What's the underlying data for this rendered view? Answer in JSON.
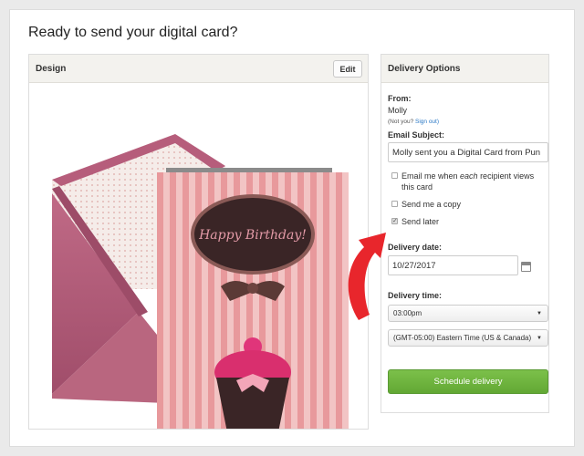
{
  "page": {
    "title": "Ready to send your digital card?"
  },
  "design": {
    "title": "Design",
    "edit_label": "Edit",
    "card_text": "Happy Birthday!"
  },
  "delivery": {
    "title": "Delivery Options",
    "from_label": "From:",
    "from_name": "Molly",
    "not_you": "(Not you?",
    "sign_out": "Sign out)",
    "subject_label": "Email Subject:",
    "subject_value": "Molly sent you a Digital Card from Pun",
    "checkboxes": [
      {
        "prefix": "Email me when ",
        "emph": "each",
        "suffix": " recipient views this card",
        "checked": false
      },
      {
        "label": "Send me a copy",
        "checked": false
      },
      {
        "label": "Send later",
        "checked": true
      }
    ],
    "date_label": "Delivery date:",
    "date_value": "10/27/2017",
    "time_label": "Delivery time:",
    "time_value": "03:00pm",
    "timezone_value": "(GMT-05:00) Eastern Time (US & Canada)",
    "schedule_label": "Schedule delivery"
  },
  "colors": {
    "accent_green": "#6ab43c",
    "arrow_red": "#e8262c",
    "card_pink": "#e89a9e"
  },
  "icons": [
    "calendar-icon",
    "caret-down-icon",
    "checkbox-icon"
  ]
}
